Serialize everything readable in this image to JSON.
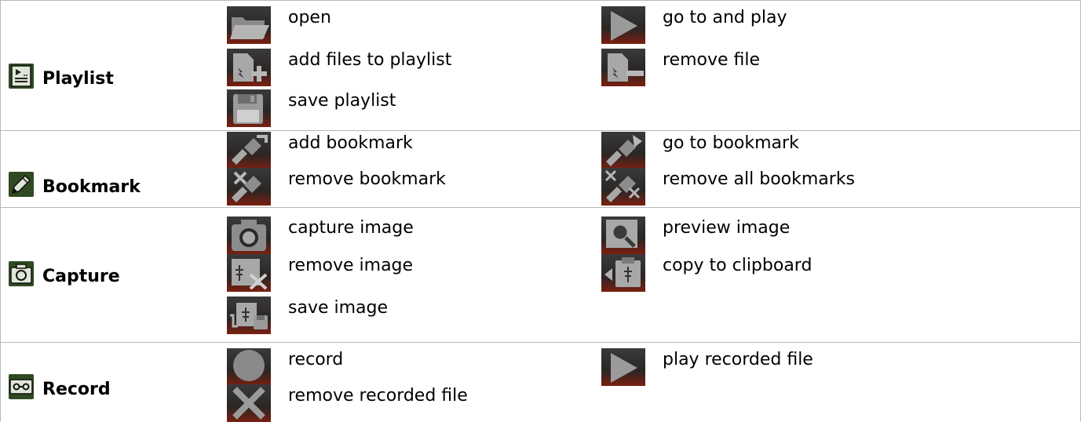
{
  "sections": [
    {
      "title": "Playlist",
      "icon": "playlist-icon",
      "items": [
        {
          "label": "open",
          "icon": "open-folder-icon"
        },
        {
          "label": "go to and play",
          "icon": "play-icon"
        },
        {
          "label": "add files to playlist",
          "icon": "add-file-icon"
        },
        {
          "label": "remove file",
          "icon": "remove-file-icon"
        },
        {
          "label": "save playlist",
          "icon": "save-icon"
        }
      ]
    },
    {
      "title": "Bookmark",
      "icon": "bookmark-icon",
      "items": [
        {
          "label": "add bookmark",
          "icon": "add-bookmark-icon"
        },
        {
          "label": "go to bookmark",
          "icon": "go-to-bookmark-icon"
        },
        {
          "label": "remove bookmark",
          "icon": "remove-bookmark-icon"
        },
        {
          "label": "remove all bookmarks",
          "icon": "remove-all-bookmarks-icon"
        }
      ]
    },
    {
      "title": "Capture",
      "icon": "camera-icon",
      "items": [
        {
          "label": "capture image",
          "icon": "capture-icon"
        },
        {
          "label": "preview image",
          "icon": "preview-icon"
        },
        {
          "label": "remove image",
          "icon": "remove-image-icon"
        },
        {
          "label": "copy to clipboard",
          "icon": "clipboard-icon"
        },
        {
          "label": "save image",
          "icon": "save-image-icon"
        }
      ]
    },
    {
      "title": "Record",
      "icon": "cassette-icon",
      "items": [
        {
          "label": "record",
          "icon": "record-icon"
        },
        {
          "label": "play recorded file",
          "icon": "play-recorded-icon"
        },
        {
          "label": "remove recorded file",
          "icon": "remove-recorded-icon"
        }
      ]
    }
  ],
  "colors": {
    "button_top": "#3a3a3a",
    "button_bottom": "#7a1f10",
    "icon_glyph": "#a8a8a8",
    "border": "#b8b8b8",
    "section_icon_bg": "#3c5a2c"
  }
}
